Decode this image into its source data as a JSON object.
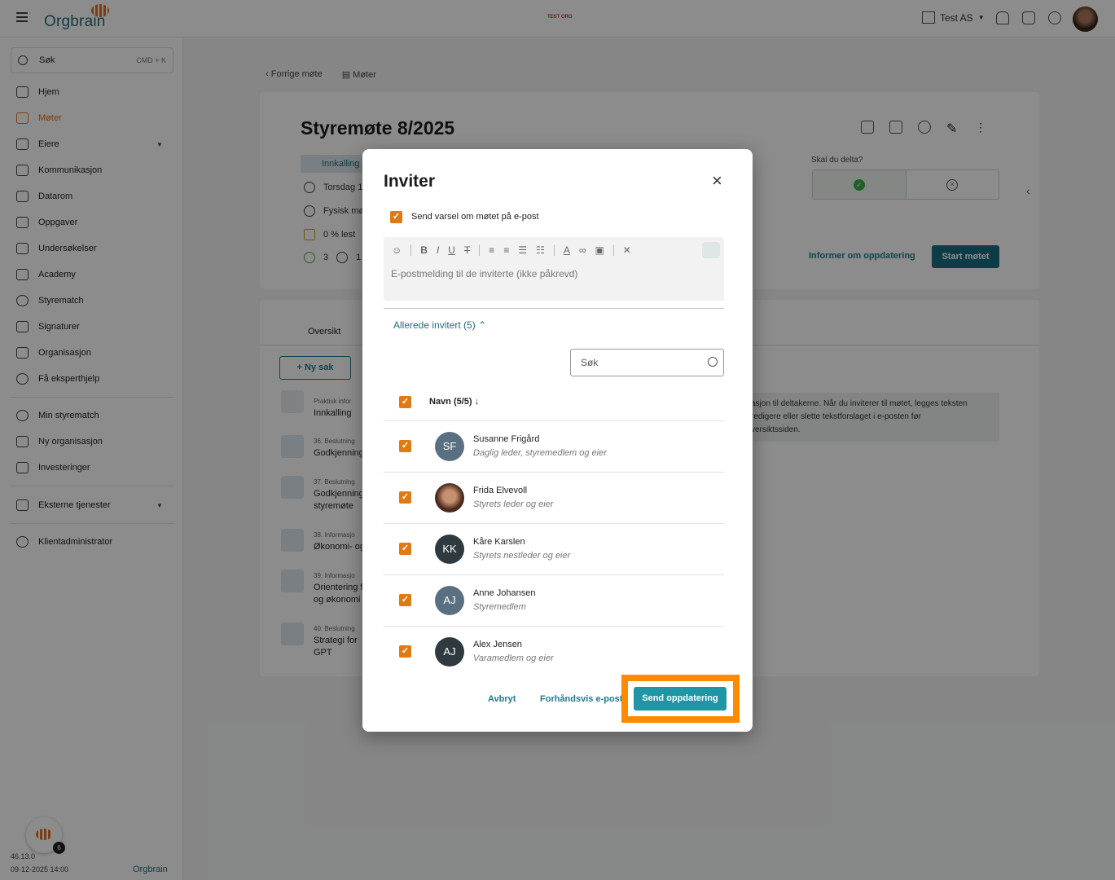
{
  "topbar": {
    "logo": "Orgbrain",
    "test_tag": "TEST ORG",
    "org_name": "Test AS"
  },
  "sidebar": {
    "search_label": "Søk",
    "search_shortcut": "CMD + K",
    "items": [
      {
        "label": "Hjem"
      },
      {
        "label": "Møter"
      },
      {
        "label": "Eiere"
      },
      {
        "label": "Kommunikasjon"
      },
      {
        "label": "Datarom"
      },
      {
        "label": "Oppgaver"
      },
      {
        "label": "Undersøkelser"
      },
      {
        "label": "Academy"
      },
      {
        "label": "Styrematch"
      },
      {
        "label": "Signaturer"
      },
      {
        "label": "Organisasjon"
      },
      {
        "label": "Få eksperthjelp"
      }
    ],
    "secondary": [
      {
        "label": "Min styrematch"
      },
      {
        "label": "Ny organisasjon"
      },
      {
        "label": "Investeringer"
      }
    ],
    "external": "Eksterne tjenester",
    "admin": "Klientadministrator",
    "badge_count": "6",
    "version": "46.13.0",
    "date": "09-12-2025 14:00",
    "footer_logo": "Orgbrain"
  },
  "main": {
    "breadcrumb_prev": "Forrige møte",
    "breadcrumb_meetings": "Møter",
    "title": "Styremøte 8/2025",
    "chip": "Innkalling",
    "meta_day": "Torsdag 1",
    "meta_place": "Fysisk mø",
    "meta_read": "0 % lest",
    "meta_yes": "3",
    "meta_no": "1",
    "delta_question": "Skal du delta?",
    "inform_label": "Informer om oppdatering",
    "start_label": "Start møtet",
    "tab_overview": "Oversikt",
    "new_item": "Ny sak",
    "agenda": [
      {
        "sub": "Praktisk infor",
        "main": "Innkalling"
      },
      {
        "sub": "36. Beslutning",
        "main": "Godkjenning"
      },
      {
        "sub": "37. Beslutning",
        "main": "Godkjenning",
        "main2": "styremøte"
      },
      {
        "sub": "38. Informasjo",
        "main": "Økonomi- og"
      },
      {
        "sub": "39. Informasjo",
        "main": "Orientering f",
        "main2": "og økonomi"
      },
      {
        "sub": "40. Beslutning",
        "main": "Strategi for",
        "main2": "GPT"
      }
    ],
    "info_text_1": "asjon til deltakerne. Når du inviterer til møtet, legges teksten",
    "info_text_2": "redigere eller slette tekstforslaget i e-posten før",
    "info_text_3": "versiktssiden."
  },
  "modal": {
    "title": "Inviter",
    "send_notice": "Send varsel om møtet på e-post",
    "placeholder": "E-postmelding til de inviterte (ikke påkrevd)",
    "already_invited": "Allerede invitert (5)",
    "search_placeholder": "Søk",
    "column_name": "Navn (5/5)",
    "people": [
      {
        "initials": "SF",
        "name": "Susanne Frigård",
        "role": "Daglig leder, styremedlem og eier",
        "color": "#5a7080"
      },
      {
        "initials": "",
        "name": "Frida Elvevoll",
        "role": "Styrets leder og eier",
        "color": "#5b3a2c"
      },
      {
        "initials": "KK",
        "name": "Kåre Karslen",
        "role": "Styrets nestleder og eier",
        "color": "#2e3a40"
      },
      {
        "initials": "AJ",
        "name": "Anne Johansen",
        "role": "Styremedlem",
        "color": "#5a7080"
      },
      {
        "initials": "AJ",
        "name": "Alex Jensen",
        "role": "Varamedlem og eier",
        "color": "#2e3a40"
      }
    ],
    "cancel": "Avbryt",
    "preview": "Forhåndsvis e-post",
    "send": "Send oppdatering"
  }
}
